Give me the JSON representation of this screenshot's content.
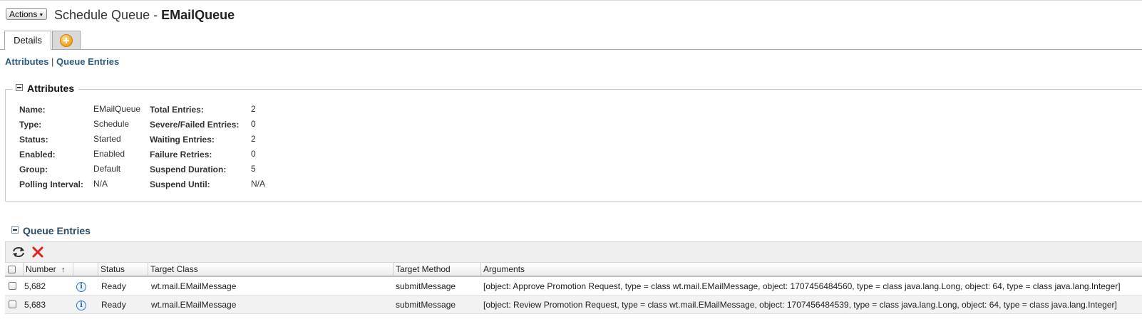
{
  "header": {
    "actions_label": "Actions",
    "title_prefix": "Schedule Queue - ",
    "title_name": "EMailQueue"
  },
  "tabs": [
    {
      "label": "Details",
      "active": true
    }
  ],
  "links": {
    "attributes": "Attributes",
    "separator": "|",
    "queue_entries": "Queue Entries"
  },
  "attributes": {
    "legend": "Attributes",
    "left": [
      {
        "label": "Name:",
        "value": "EMailQueue"
      },
      {
        "label": "Type:",
        "value": "Schedule"
      },
      {
        "label": "Status:",
        "value": "Started"
      },
      {
        "label": "Enabled:",
        "value": "Enabled"
      },
      {
        "label": "Group:",
        "value": "Default"
      },
      {
        "label": "Polling Interval:",
        "value": "N/A"
      }
    ],
    "right": [
      {
        "label": "Total Entries:",
        "value": "2"
      },
      {
        "label": "Severe/Failed Entries:",
        "value": "0"
      },
      {
        "label": "Waiting Entries:",
        "value": "2"
      },
      {
        "label": "Failure Retries:",
        "value": "0"
      },
      {
        "label": "Suspend Duration:",
        "value": "5"
      },
      {
        "label": "Suspend Until:",
        "value": "N/A"
      }
    ]
  },
  "queue_entries": {
    "title": "Queue Entries",
    "toolbar": {
      "refresh_icon": "refresh-icon",
      "delete_icon": "delete-icon",
      "delete_color": "#e02020"
    },
    "columns": {
      "number": "Number",
      "sort_indicator": "↑",
      "status": "Status",
      "target_class": "Target Class",
      "target_method": "Target Method",
      "arguments": "Arguments"
    },
    "rows": [
      {
        "number": "5,682",
        "status": "Ready",
        "target_class": "wt.mail.EMailMessage",
        "target_method": "submitMessage",
        "arguments": "[object: Approve Promotion Request, type = class wt.mail.EMailMessage, object: 1707456484560, type = class java.lang.Long, object: 64, type = class java.lang.Integer]"
      },
      {
        "number": "5,683",
        "status": "Ready",
        "target_class": "wt.mail.EMailMessage",
        "target_method": "submitMessage",
        "arguments": "[object: Review Promotion Request, type = class wt.mail.EMailMessage, object: 1707456484539, type = class java.lang.Long, object: 64, type = class java.lang.Integer]"
      }
    ]
  },
  "colors": {
    "link": "#2a5d84",
    "section_title": "#2b4a63",
    "add_icon": "#f4a11e",
    "info_icon": "#3f78b5"
  }
}
